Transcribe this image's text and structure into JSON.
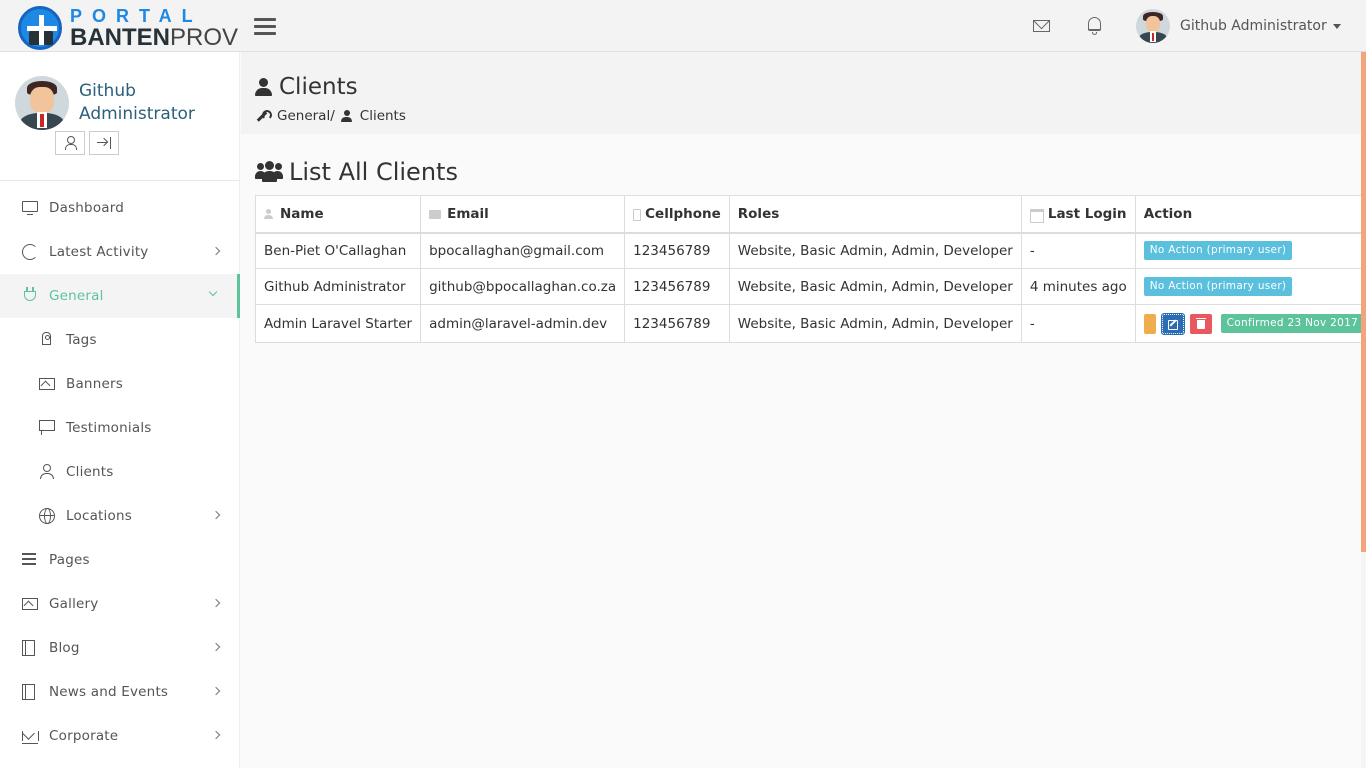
{
  "brand": {
    "top": "PORTAL",
    "bold": "BANTEN",
    "light": "PROV"
  },
  "header": {
    "user_name": "Github Administrator"
  },
  "profile": {
    "name": "Github Administrator"
  },
  "sidebar": {
    "items": [
      {
        "label": "Dashboard",
        "icon": "monitor-icon"
      },
      {
        "label": "Latest Activity",
        "icon": "refresh-icon"
      },
      {
        "label": "General",
        "icon": "plug-icon"
      },
      {
        "label": "Tags",
        "icon": "tag-icon"
      },
      {
        "label": "Banners",
        "icon": "image-icon"
      },
      {
        "label": "Testimonials",
        "icon": "chat-icon"
      },
      {
        "label": "Clients",
        "icon": "user-icon"
      },
      {
        "label": "Locations",
        "icon": "globe-icon"
      },
      {
        "label": "Pages",
        "icon": "menu-lines-icon"
      },
      {
        "label": "Gallery",
        "icon": "image-icon"
      },
      {
        "label": "Blog",
        "icon": "book-icon"
      },
      {
        "label": "News and Events",
        "icon": "book-icon"
      },
      {
        "label": "Corporate",
        "icon": "crown-icon"
      }
    ]
  },
  "page": {
    "title": "Clients",
    "breadcrumb": {
      "parent": "General/",
      "current": "Clients"
    },
    "list_title": "List All Clients"
  },
  "table": {
    "headers": [
      "Name",
      "Email",
      "Cellphone",
      "Roles",
      "Last Login",
      "Action"
    ],
    "rows": [
      {
        "name": "Ben-Piet O'Callaghan",
        "email": "bpocallaghan@gmail.com",
        "cellphone": "123456789",
        "roles": "Website, Basic Admin, Admin, Developer",
        "last_login": "-",
        "action_label": "No Action (primary user)"
      },
      {
        "name": "Github Administrator",
        "email": "github@bpocallaghan.co.za",
        "cellphone": "123456789",
        "roles": "Website, Basic Admin, Admin, Developer",
        "last_login": "4 minutes ago",
        "action_label": "No Action (primary user)"
      },
      {
        "name": "Admin Laravel Starter",
        "email": "admin@laravel-admin.dev",
        "cellphone": "123456789",
        "roles": "Website, Basic Admin, Admin, Developer",
        "last_login": "-",
        "action_label": "Confirmed 23 Nov 2017"
      }
    ]
  },
  "colors": {
    "accent": "#5cc39a",
    "info": "#5bc0de",
    "danger": "#e8585f",
    "warning": "#f0ad4e",
    "primary": "#2a6db5"
  }
}
